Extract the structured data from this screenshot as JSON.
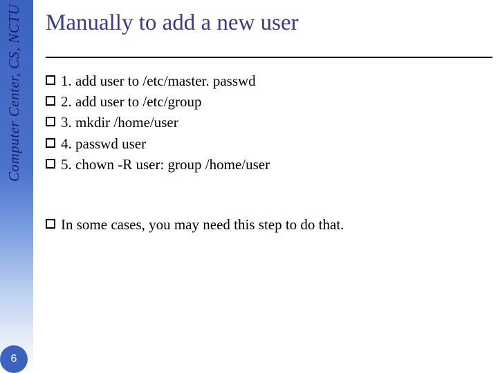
{
  "sidebar": {
    "label": "Computer Center, CS, NCTU"
  },
  "title": "Manually to add a new user",
  "steps": [
    "1. add user to /etc/master. passwd",
    "2. add user to /etc/group",
    "3. mkdir /home/user",
    "4. passwd user",
    "5. chown -R user: group /home/user"
  ],
  "note": "In some cases, you may need this step to do that.",
  "page_number": "6"
}
